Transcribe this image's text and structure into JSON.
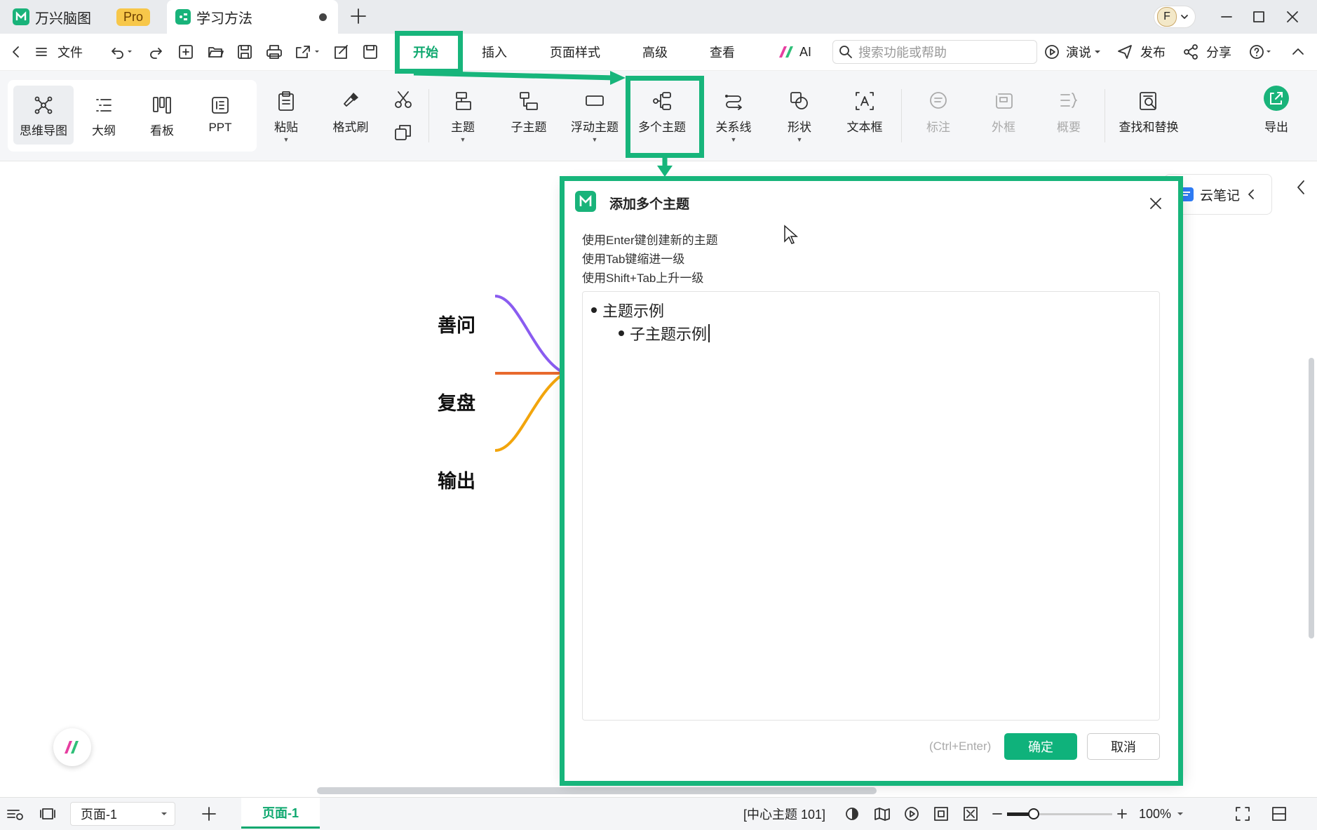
{
  "titlebar": {
    "app_name": "万兴脑图",
    "pro_badge": "Pro",
    "doc_tab": "学习方法",
    "avatar_letter": "F"
  },
  "menubar": {
    "file": "文件",
    "tabs": [
      "开始",
      "插入",
      "页面样式",
      "高级",
      "查看"
    ],
    "ai": "AI",
    "search_placeholder": "搜索功能或帮助",
    "present": "演说",
    "publish": "发布",
    "share": "分享"
  },
  "ribbon": {
    "views": [
      "思维导图",
      "大纲",
      "看板",
      "PPT"
    ],
    "paste": "粘贴",
    "format_painter": "格式刷",
    "topic": "主题",
    "subtopic": "子主题",
    "floating": "浮动主题",
    "multi": "多个主题",
    "relation": "关系线",
    "shape": "形状",
    "textbox": "文本框",
    "callout": "标注",
    "boundary": "外框",
    "summary": "概要",
    "find_replace": "查找和替换",
    "export": "导出"
  },
  "canvas": {
    "nodes": [
      "善问",
      "复盘",
      "输出"
    ],
    "cloud_notes": "云笔记",
    "branch_colors": [
      "#8a5cf0",
      "#e8692d",
      "#f2a50c"
    ]
  },
  "dialog": {
    "title": "添加多个主题",
    "hints": [
      "使用Enter键创建新的主题",
      "使用Tab键缩进一级",
      "使用Shift+Tab上升一级"
    ],
    "items": [
      "主题示例",
      "子主题示例"
    ],
    "shortcut": "(Ctrl+Enter)",
    "ok": "确定",
    "cancel": "取消"
  },
  "statusbar": {
    "page_select": "页面-1",
    "page_tab": "页面-1",
    "topic_count": "[中心主题 101]",
    "zoom": "100%",
    "zoom_level": 1.0
  },
  "accent": "#17b57b"
}
